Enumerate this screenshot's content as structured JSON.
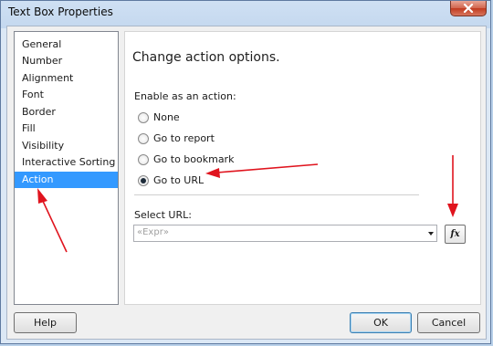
{
  "window": {
    "title": "Text Box Properties"
  },
  "nav": {
    "items": [
      {
        "label": "General"
      },
      {
        "label": "Number"
      },
      {
        "label": "Alignment"
      },
      {
        "label": "Font"
      },
      {
        "label": "Border"
      },
      {
        "label": "Fill"
      },
      {
        "label": "Visibility"
      },
      {
        "label": "Interactive Sorting"
      },
      {
        "label": "Action",
        "selected": true
      }
    ]
  },
  "panel": {
    "heading": "Change action options.",
    "group_label": "Enable as an action:",
    "options": [
      {
        "label": "None",
        "checked": false
      },
      {
        "label": "Go to report",
        "checked": false
      },
      {
        "label": "Go to bookmark",
        "checked": false
      },
      {
        "label": "Go to URL",
        "checked": true
      }
    ],
    "url_label": "Select URL:",
    "url_value": "«Expr»",
    "fx_label": "fx"
  },
  "buttons": {
    "help": "Help",
    "ok": "OK",
    "cancel": "Cancel"
  },
  "colors": {
    "selection": "#3399ff",
    "annotation_arrow": "#e0141e"
  }
}
